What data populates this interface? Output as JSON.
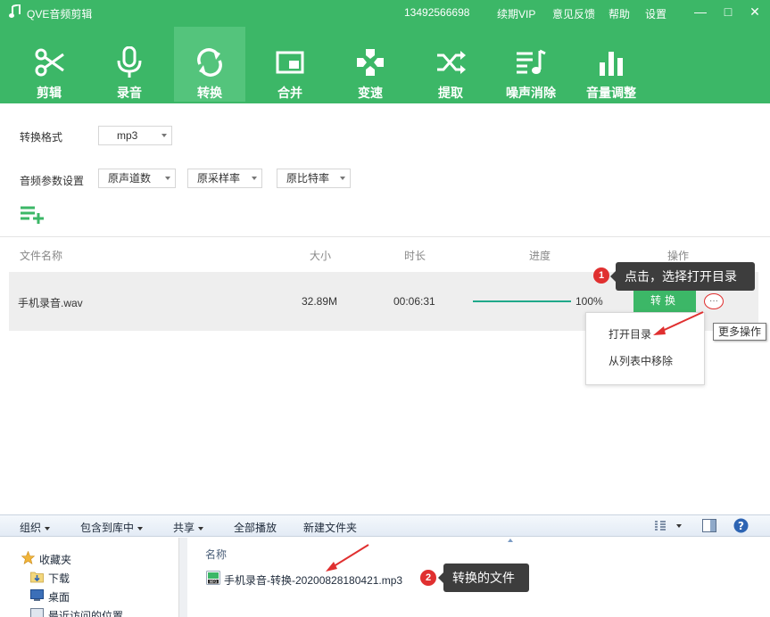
{
  "app": {
    "title": "QVE音频剪辑",
    "phone": "13492566698",
    "vip": "续期VIP",
    "feedback": "意见反馈",
    "help": "帮助",
    "settings": "设置",
    "minimize": "—",
    "maximize": "□",
    "close": "✕"
  },
  "toolbar": [
    {
      "label": "剪辑",
      "icon": "scissors-icon",
      "active": false
    },
    {
      "label": "录音",
      "icon": "microphone-icon",
      "active": false
    },
    {
      "label": "转换",
      "icon": "convert-icon",
      "active": true
    },
    {
      "label": "合并",
      "icon": "merge-icon",
      "active": false
    },
    {
      "label": "变速",
      "icon": "speed-icon",
      "active": false
    },
    {
      "label": "提取",
      "icon": "extract-icon",
      "active": false
    },
    {
      "label": "噪声消除",
      "icon": "noise-removal-icon",
      "active": false
    },
    {
      "label": "音量调整",
      "icon": "volume-adjust-icon",
      "active": false
    }
  ],
  "settings": {
    "format_label": "转换格式",
    "format_value": "mp3",
    "params_label": "音频参数设置",
    "channels_value": "原声道数",
    "sample_rate_value": "原采样率",
    "bitrate_value": "原比特率"
  },
  "table": {
    "headers": {
      "name": "文件名称",
      "size": "大小",
      "duration": "时长",
      "progress": "进度",
      "action": "操作"
    },
    "rows": [
      {
        "name": "手机录音.wav",
        "size": "32.89M",
        "duration": "00:06:31",
        "progress": 1.0,
        "progress_text": "100%",
        "button": "转换"
      }
    ]
  },
  "menu": {
    "open_dir": "打开目录",
    "remove": "从列表中移除",
    "more_tooltip": "更多操作",
    "more_glyph": "···"
  },
  "annotations": [
    {
      "number": "1",
      "text": "点击，选择打开目录"
    },
    {
      "number": "2",
      "text": "转换的文件"
    }
  ],
  "explorer": {
    "toolbar": {
      "organize": "组织",
      "include_library": "包含到库中",
      "share": "共享",
      "play_all": "全部播放",
      "new_folder": "新建文件夹"
    },
    "nav": {
      "favorites": "收藏夹",
      "downloads": "下载",
      "desktop": "桌面",
      "recent": "最近访问的位置"
    },
    "column_name": "名称",
    "file_name": "手机录音-转换-20200828180421.mp3"
  },
  "colors": {
    "brand_green": "#3cb767",
    "active_tab": "#54c47c",
    "progress": "#1fa88a",
    "callout_bg": "#3d3d3d",
    "badge_red": "#e03030"
  }
}
